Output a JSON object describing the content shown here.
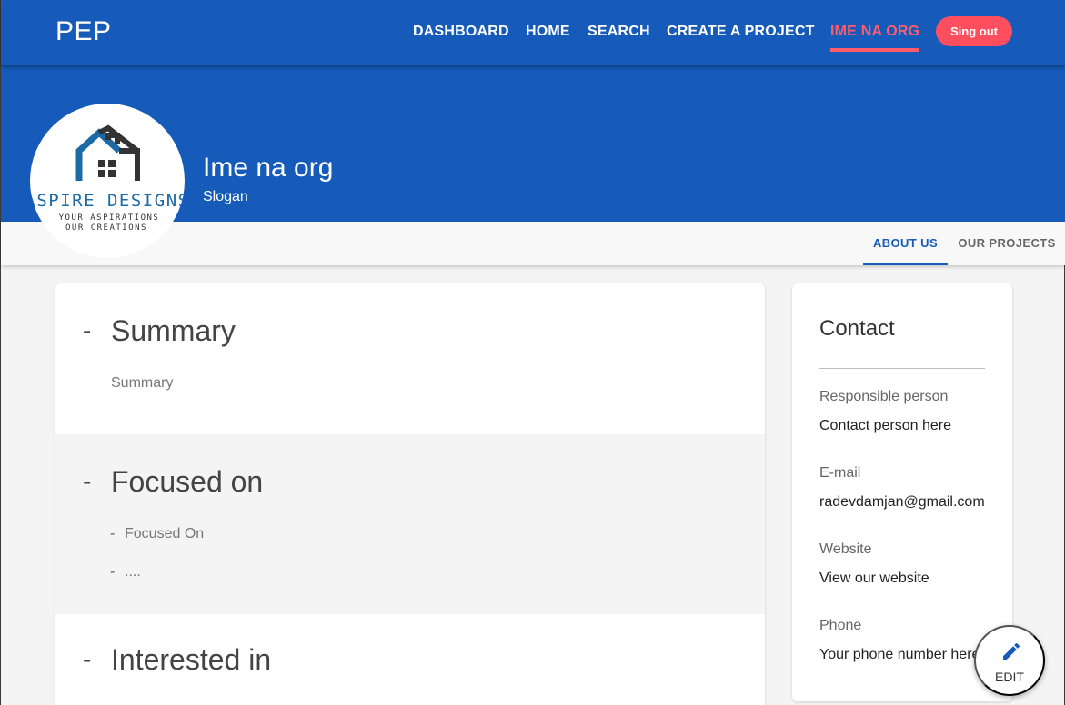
{
  "brand": "PEP",
  "nav": {
    "items": [
      {
        "label": "DASHBOARD"
      },
      {
        "label": "HOME"
      },
      {
        "label": "SEARCH"
      },
      {
        "label": "CREATE A PROJECT"
      },
      {
        "label": "IME NA ORG"
      }
    ],
    "signout_label": "Sing out"
  },
  "org": {
    "name": "Ime na org",
    "slogan": "Slogan",
    "logo_text": "ASPIRE DESIGNS",
    "logo_tagline_1": "YOUR ASPIRATIONS",
    "logo_tagline_2": "OUR CREATIONS"
  },
  "tabs": [
    {
      "label": "ABOUT US"
    },
    {
      "label": "OUR PROJECTS"
    }
  ],
  "sections": {
    "summary": {
      "title": "Summary",
      "text": "Summary"
    },
    "focused": {
      "title": "Focused on",
      "items": [
        "Focused On",
        "...."
      ]
    },
    "interested": {
      "title": "Interested in"
    }
  },
  "contact": {
    "title": "Contact",
    "responsible_label": "Responsible person",
    "responsible_value": "Contact person here",
    "email_label": "E-mail",
    "email_value": "radevdamjan@gmail.com",
    "website_label": "Website",
    "website_value": "View our website",
    "phone_label": "Phone",
    "phone_value": "Your phone number here"
  },
  "edit_label": "EDIT",
  "colors": {
    "primary": "#165bba",
    "accent": "#ff5c6b",
    "signout": "#ff4f5f"
  },
  "icons": [
    "pencil-icon",
    "house-logo-icon"
  ]
}
